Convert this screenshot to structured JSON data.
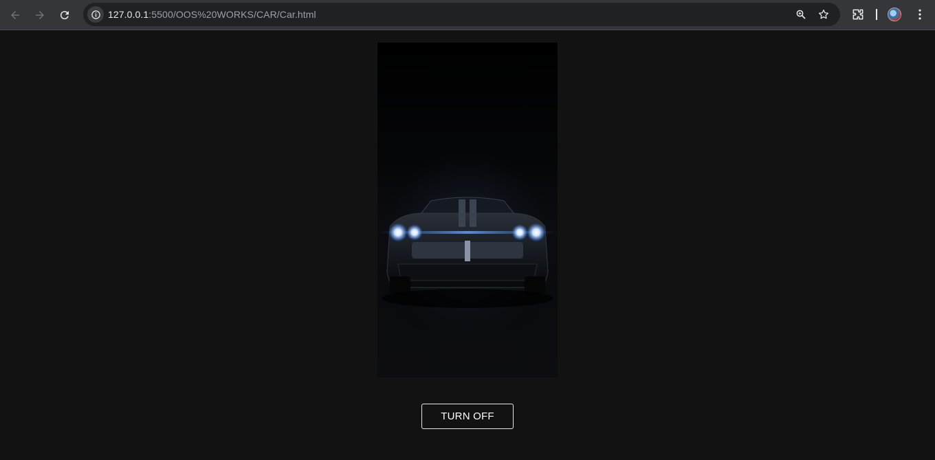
{
  "browser": {
    "url_host": "127.0.0.1",
    "url_path": ":5500/OOS%20WORKS/CAR/Car.html",
    "icons": [
      "back-icon",
      "forward-icon",
      "reload-icon",
      "site-info-icon",
      "zoom-icon",
      "bookmark-star-icon",
      "extensions-icon",
      "profile-avatar",
      "menu-icon"
    ]
  },
  "page": {
    "button_label": "TURN OFF",
    "background": "#121212",
    "button_border": "#e6e6e6",
    "headlight_color": "#7fb6ff"
  }
}
